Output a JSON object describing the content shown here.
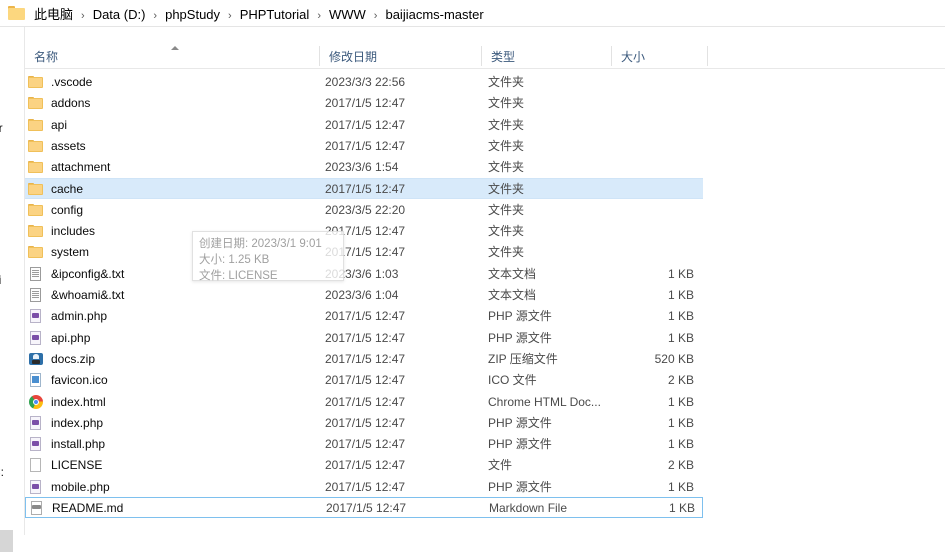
{
  "addressbar": {
    "folder_icon": "folder-icon",
    "separator": "›",
    "crumbs": [
      {
        "label": "此电脑"
      },
      {
        "label": "Data (D:)"
      },
      {
        "label": "phpStudy"
      },
      {
        "label": "PHPTutorial"
      },
      {
        "label": "WWW"
      },
      {
        "label": "baijiacms-master"
      }
    ]
  },
  "navpane": {
    "items": [
      {
        "icon": "pin-icon",
        "label": ""
      },
      {
        "icon": "pin-icon",
        "label": ""
      },
      {
        "icon": "pin-icon",
        "label": ""
      },
      {
        "icon": "pin-icon",
        "label": ""
      },
      {
        "icon": "",
        "label": "er"
      },
      {
        "icon": "",
        "label": "ni"
      },
      {
        "icon": "",
        "label": "C:"
      }
    ]
  },
  "columns": {
    "name": "名称",
    "date": "修改日期",
    "type": "类型",
    "size": "大小",
    "sort_indicator": "ascending-sort-caret-icon"
  },
  "files": [
    {
      "name": ".vscode",
      "icon": "folder-icon",
      "date": "2023/3/3 22:56",
      "type": "文件夹",
      "size": "",
      "state": ""
    },
    {
      "name": "addons",
      "icon": "folder-icon",
      "date": "2017/1/5 12:47",
      "type": "文件夹",
      "size": "",
      "state": ""
    },
    {
      "name": "api",
      "icon": "folder-icon",
      "date": "2017/1/5 12:47",
      "type": "文件夹",
      "size": "",
      "state": ""
    },
    {
      "name": "assets",
      "icon": "folder-icon",
      "date": "2017/1/5 12:47",
      "type": "文件夹",
      "size": "",
      "state": ""
    },
    {
      "name": "attachment",
      "icon": "folder-icon",
      "date": "2023/3/6 1:54",
      "type": "文件夹",
      "size": "",
      "state": ""
    },
    {
      "name": "cache",
      "icon": "folder-icon",
      "date": "2017/1/5 12:47",
      "type": "文件夹",
      "size": "",
      "state": "hover"
    },
    {
      "name": "config",
      "icon": "folder-icon",
      "date": "2023/3/5 22:20",
      "type": "文件夹",
      "size": "",
      "state": ""
    },
    {
      "name": "includes",
      "icon": "folder-icon",
      "date": "2017/1/5 12:47",
      "type": "文件夹",
      "size": "",
      "state": ""
    },
    {
      "name": "system",
      "icon": "folder-icon",
      "date": "2017/1/5 12:47",
      "type": "文件夹",
      "size": "",
      "state": ""
    },
    {
      "name": "&ipconfig&.txt",
      "icon": "text-file-icon",
      "date": "2023/3/6 1:03",
      "type": "文本文档",
      "size": "1 KB",
      "state": ""
    },
    {
      "name": "&whoami&.txt",
      "icon": "text-file-icon",
      "date": "2023/3/6 1:04",
      "type": "文本文档",
      "size": "1 KB",
      "state": ""
    },
    {
      "name": "admin.php",
      "icon": "php-file-icon",
      "date": "2017/1/5 12:47",
      "type": "PHP 源文件",
      "size": "1 KB",
      "state": ""
    },
    {
      "name": "api.php",
      "icon": "php-file-icon",
      "date": "2017/1/5 12:47",
      "type": "PHP 源文件",
      "size": "1 KB",
      "state": ""
    },
    {
      "name": "docs.zip",
      "icon": "zip-file-icon",
      "date": "2017/1/5 12:47",
      "type": "ZIP 压缩文件",
      "size": "520 KB",
      "state": ""
    },
    {
      "name": "favicon.ico",
      "icon": "ico-file-icon",
      "date": "2017/1/5 12:47",
      "type": "ICO 文件",
      "size": "2 KB",
      "state": ""
    },
    {
      "name": "index.html",
      "icon": "chrome-icon",
      "date": "2017/1/5 12:47",
      "type": "Chrome HTML Doc...",
      "size": "1 KB",
      "state": ""
    },
    {
      "name": "index.php",
      "icon": "php-file-icon",
      "date": "2017/1/5 12:47",
      "type": "PHP 源文件",
      "size": "1 KB",
      "state": ""
    },
    {
      "name": "install.php",
      "icon": "php-file-icon",
      "date": "2017/1/5 12:47",
      "type": "PHP 源文件",
      "size": "1 KB",
      "state": ""
    },
    {
      "name": "LICENSE",
      "icon": "generic-file-icon",
      "date": "2017/1/5 12:47",
      "type": "文件",
      "size": "2 KB",
      "state": ""
    },
    {
      "name": "mobile.php",
      "icon": "php-file-icon",
      "date": "2017/1/5 12:47",
      "type": "PHP 源文件",
      "size": "1 KB",
      "state": ""
    },
    {
      "name": "README.md",
      "icon": "markdown-file-icon",
      "date": "2017/1/5 12:47",
      "type": "Markdown File",
      "size": "1 KB",
      "state": "focus"
    }
  ],
  "tooltip": {
    "line1": "创建日期: 2023/3/1 9:01",
    "line2": "大小: 1.25 KB",
    "line3": "文件: LICENSE"
  },
  "colors": {
    "hover_row": "#d8eafa",
    "focus_border": "#7ec0ee",
    "header_text": "#3c5a7d",
    "folder_fill": "#fbd383"
  }
}
